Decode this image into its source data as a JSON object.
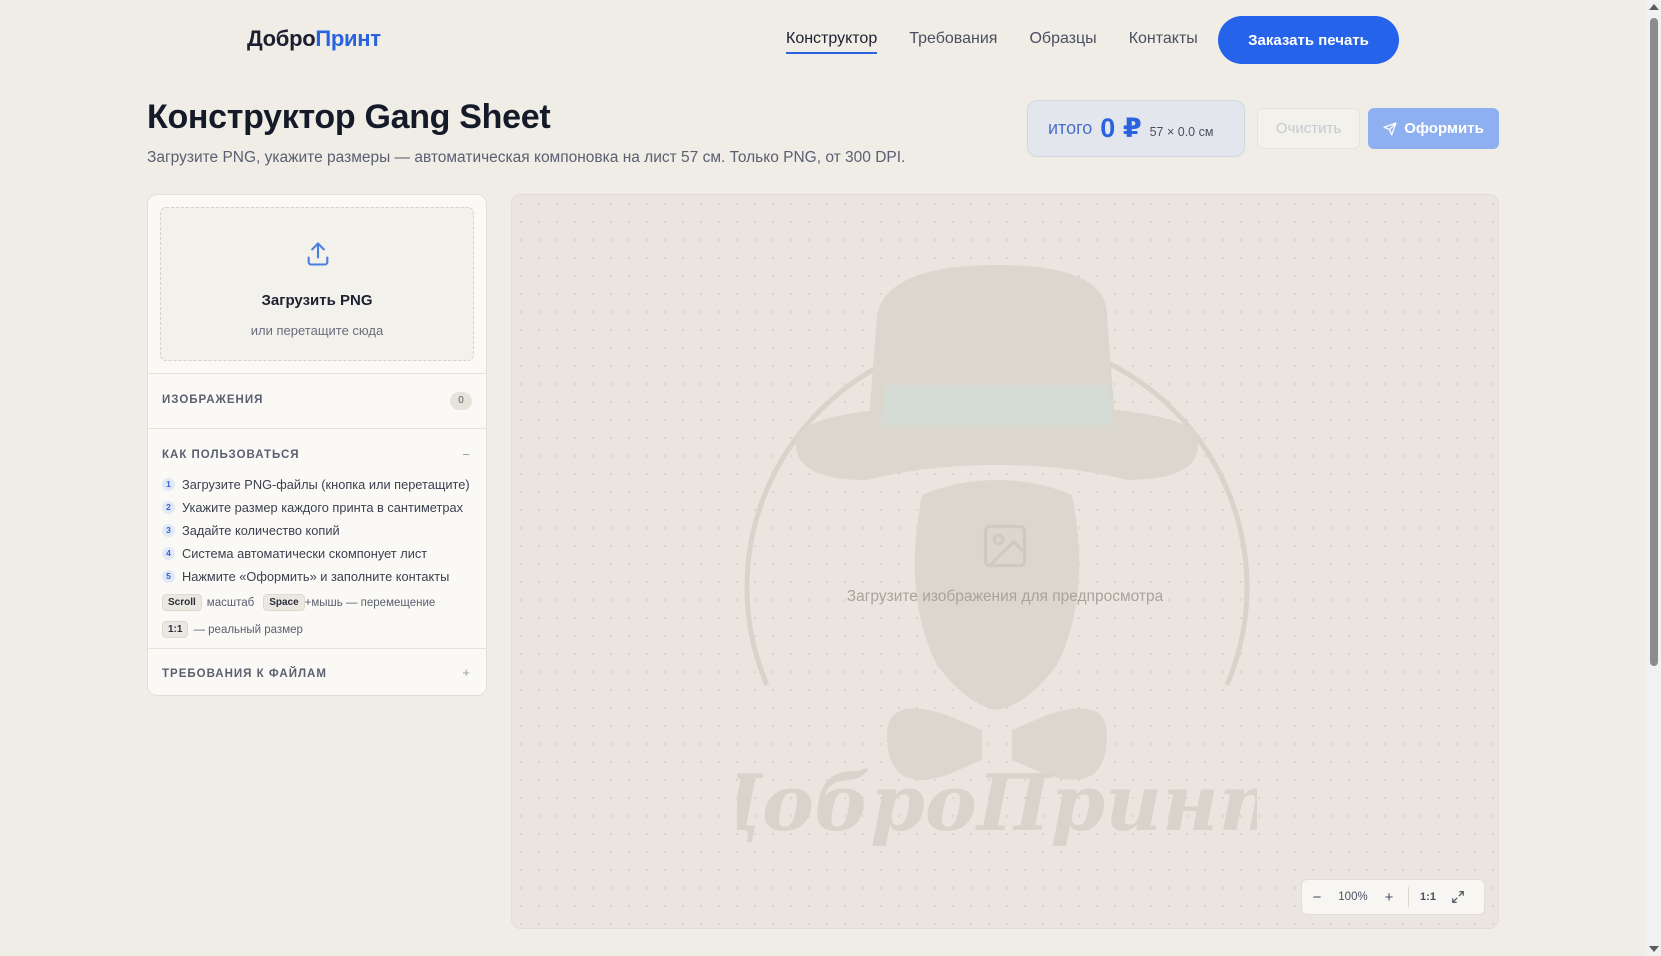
{
  "header": {
    "logo_part1": "Добро",
    "logo_part2": "Принт",
    "nav": [
      {
        "label": "Конструктор",
        "active": true
      },
      {
        "label": "Требования"
      },
      {
        "label": "Образцы"
      },
      {
        "label": "Контакты"
      }
    ],
    "cta_label": "Заказать печать"
  },
  "page": {
    "title": "Конструктор Gang Sheet",
    "subtitle": "Загрузите PNG, укажите размеры — автоматическая компоновка на лист 57 см. Только PNG, от 300 DPI."
  },
  "summary": {
    "total_label": "итого",
    "total_value": "0 ₽",
    "sheet_size": "57 × 0.0 см",
    "clear_label": "Очистить",
    "order_label": "Оформить"
  },
  "sidebar": {
    "upload_title": "Загрузить PNG",
    "upload_sub": "или перетащите сюда",
    "images_title": "ИЗОБРАЖЕНИЯ",
    "images_count": "0",
    "howto_title": "КАК ПОЛЬЗОВАТЬСЯ",
    "howto_toggle": "−",
    "steps": [
      {
        "num": "1",
        "text": "Загрузите PNG-файлы (кнопка или перетащите)"
      },
      {
        "num": "2",
        "text": "Укажите размер каждого принта в сантиметрах"
      },
      {
        "num": "3",
        "text": "Задайте количество копий"
      },
      {
        "num": "4",
        "text": "Система автоматически скомпонует лист"
      },
      {
        "num": "5",
        "text": "Нажмите «Оформить» и заполните контакты"
      }
    ],
    "hints": {
      "scroll_key": "Scroll",
      "scroll_text": "масштаб",
      "space_key": "Space",
      "space_text": "+мышь — перемещение",
      "one_key": "1:1",
      "one_text": "— реальный размер"
    },
    "req_title": "ТРЕБОВАНИЯ К ФАЙЛАМ",
    "req_toggle": "+"
  },
  "canvas": {
    "placeholder": "Загрузите изображения для предпросмотра",
    "watermark_text": "ДоброПринт",
    "zoom_minus": "−",
    "zoom_value": "100%",
    "zoom_plus": "+",
    "zoom_one": "1:1"
  },
  "colors": {
    "accent": "#2563eb",
    "background": "#f0ede6"
  }
}
